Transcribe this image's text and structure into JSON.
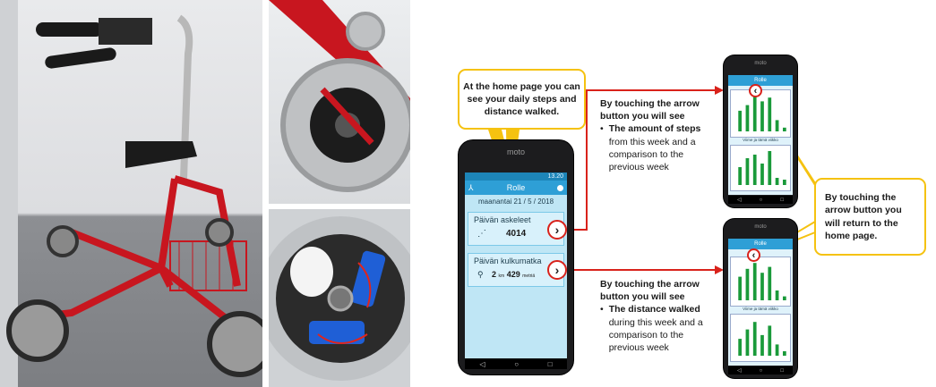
{
  "main_phone": {
    "brand": "moto",
    "status_time": "13.20",
    "app_title": "Rolle",
    "date": "maanantai 21 / 5 / 2018",
    "steps_card": {
      "title": "Päivän askeleet",
      "value": "4014",
      "arrow": "›"
    },
    "distance_card": {
      "title": "Päivän kulkumatka",
      "km_value": "2",
      "km_unit": "km",
      "m_value": "429",
      "m_unit": "metriä",
      "arrow": "›"
    },
    "nav": {
      "back": "◁",
      "home": "○",
      "recents": "□"
    }
  },
  "steps_phone": {
    "brand": "moto",
    "back_arrow": "‹",
    "app_title": "Rolle",
    "week_label": "Viime ja tämä viikko",
    "steps_this_week": [
      0.55,
      0.7,
      0.95,
      0.8,
      0.9,
      0.3,
      0.1
    ],
    "steps_prev_week": [
      0.5,
      0.75,
      0.85,
      0.6,
      0.95,
      0.2,
      0.15
    ],
    "nav": {
      "back": "◁",
      "home": "○",
      "recents": "□"
    }
  },
  "distance_phone": {
    "brand": "moto",
    "back_arrow": "‹",
    "app_title": "Rolle",
    "week_label": "Viime ja tämä viikko",
    "distance_this_week": [
      0.6,
      0.8,
      0.95,
      0.7,
      0.85,
      0.25,
      0.1
    ],
    "distance_prev_week": [
      0.45,
      0.7,
      0.9,
      0.55,
      0.8,
      0.3,
      0.12
    ],
    "nav": {
      "back": "◁",
      "home": "○",
      "recents": "□"
    }
  },
  "callouts": {
    "home": "At the home page you can see your daily steps and distance walked.",
    "return": "By touching the arrow button you will return to the home page."
  },
  "notes": {
    "steps": {
      "intro": "By touching the arrow button you will see",
      "bold": "The amount of steps",
      "rest": "from this week and a comparison to the previous week"
    },
    "distance": {
      "intro": "By touching the arrow button you will see",
      "bold": "The distance walked",
      "rest": "during this week and a comparison to the previous week"
    }
  },
  "colors": {
    "accent_red": "#d9221b",
    "callout_yellow": "#f5c210",
    "app_blue": "#2e9fd6",
    "bar_green": "#1a9a3a"
  }
}
